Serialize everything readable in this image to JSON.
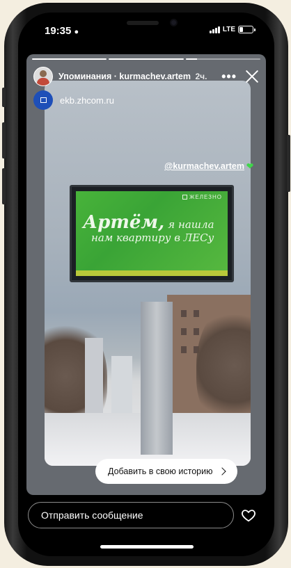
{
  "status": {
    "time": "19:35",
    "network": "LTE"
  },
  "story": {
    "progress": [
      1,
      1,
      0.15
    ],
    "header": {
      "title": "Упоминания · kurmachev.artem",
      "time": "2ч.",
      "more": "•••"
    },
    "site": {
      "url": "ekb.zhcom.ru"
    },
    "mention": "@kurmachev.artem",
    "billboard": {
      "brand": "ЖЕЛЕЗНО",
      "word": "Артём,",
      "rest1": "я нашла",
      "rest2": "нам квартиру в ЛЕСу"
    },
    "add_story_label": "Добавить в свою историю"
  },
  "message": {
    "placeholder": "Отправить сообщение"
  },
  "colors": {
    "accent_green": "#3fd64a",
    "billboard": "#48b33a",
    "site_logo": "#1e4fb8"
  }
}
